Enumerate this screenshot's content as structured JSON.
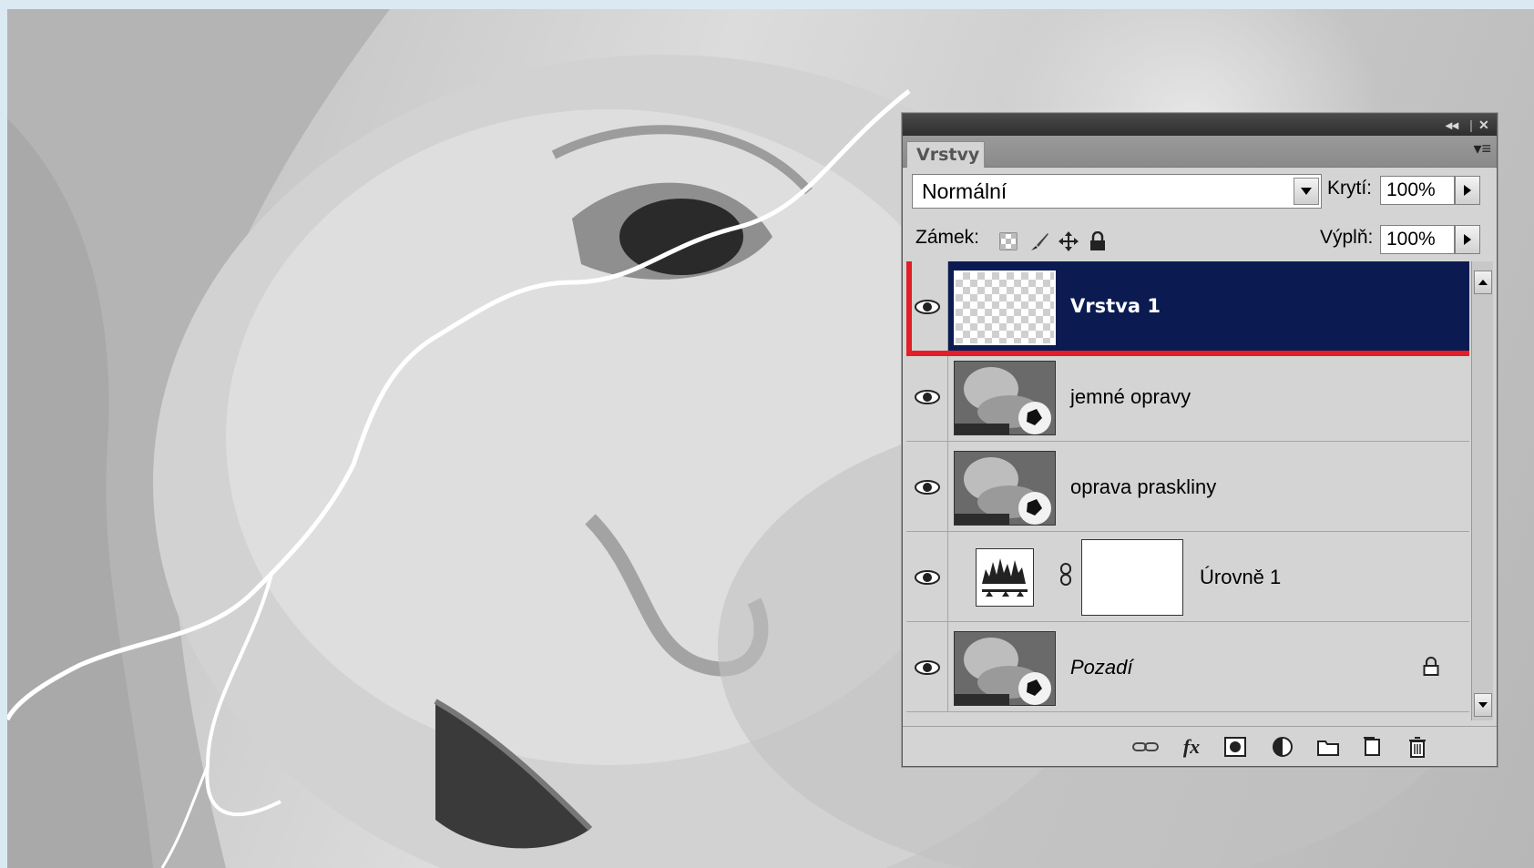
{
  "panel": {
    "tab_label": "Vrstvy",
    "blend_mode": "Normální",
    "opacity_label": "Krytí:",
    "opacity_value": "100%",
    "lock_label": "Zámek:",
    "fill_label": "Výplň:",
    "fill_value": "100%",
    "lock_icons": [
      "lock-transparent-pixels-icon",
      "lock-image-pixels-icon",
      "lock-position-icon",
      "lock-all-icon"
    ],
    "bottom_icons": [
      "link-layers-icon",
      "layer-style-fx-icon",
      "layer-mask-icon",
      "adjustment-layer-icon",
      "group-folder-icon",
      "new-layer-icon",
      "trash-icon"
    ]
  },
  "layers": [
    {
      "name": "Vrstva 1",
      "selected": true,
      "type": "empty"
    },
    {
      "name": "jemné opravy",
      "selected": false,
      "type": "photo"
    },
    {
      "name": "oprava praskliny",
      "selected": false,
      "type": "photo"
    },
    {
      "name": "Úrovně 1",
      "selected": false,
      "type": "adjustment-levels"
    },
    {
      "name": "Pozadí",
      "selected": false,
      "type": "photo",
      "locked": true
    }
  ],
  "colors": {
    "selection": "#0b1b52",
    "highlight_frame": "#e21e26",
    "page_background": "#dbe9f3"
  }
}
